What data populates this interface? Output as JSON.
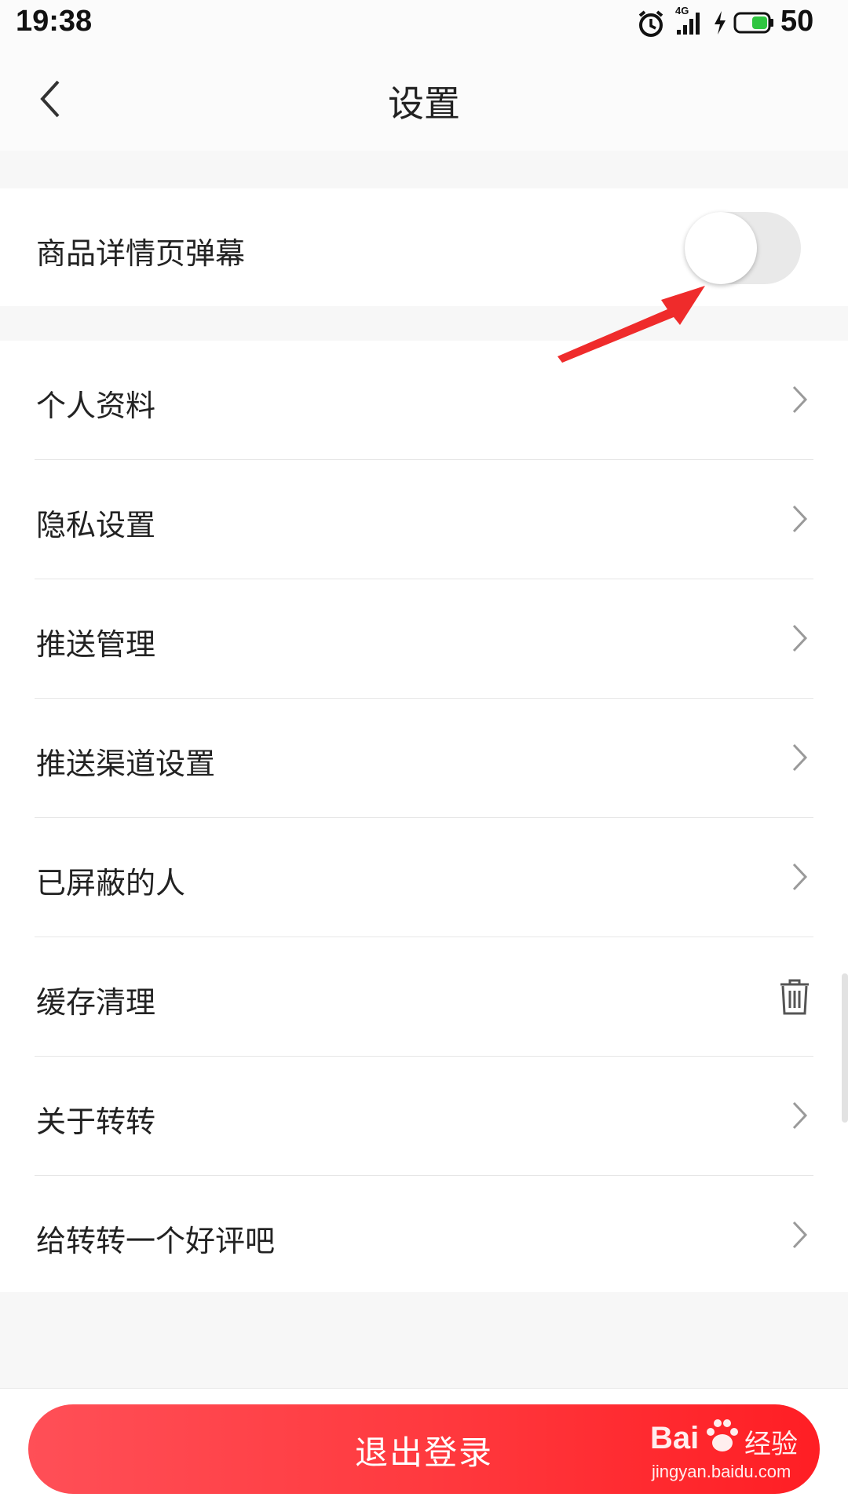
{
  "status_bar": {
    "time": "19:38",
    "network": "4G",
    "battery": "50",
    "icons": [
      "alarm-icon",
      "signal-icon",
      "charging-icon",
      "battery-icon"
    ]
  },
  "nav": {
    "back_icon": "chevron-left-icon",
    "title": "设置"
  },
  "toggle_row": {
    "label": "商品详情页弹幕",
    "enabled": false
  },
  "list": {
    "items": [
      {
        "label": "个人资料",
        "icon": "chevron-right-icon"
      },
      {
        "label": "隐私设置",
        "icon": "chevron-right-icon"
      },
      {
        "label": "推送管理",
        "icon": "chevron-right-icon"
      },
      {
        "label": "推送渠道设置",
        "icon": "chevron-right-icon"
      },
      {
        "label": "已屏蔽的人",
        "icon": "chevron-right-icon"
      },
      {
        "label": "缓存清理",
        "icon": "trash-icon"
      },
      {
        "label": "关于转转",
        "icon": "chevron-right-icon"
      },
      {
        "label": "给转转一个好评吧",
        "icon": "chevron-right-icon"
      }
    ]
  },
  "logout": {
    "label": "退出登录"
  },
  "watermark": {
    "brand": "Bai",
    "brand_suffix": "经验",
    "url": "jingyan.baidu.com"
  },
  "colors": {
    "accent": "#ff3a3f",
    "background": "#f7f7f7",
    "annotation_arrow": "#ef2b2b",
    "battery_fill": "#2fc540"
  }
}
